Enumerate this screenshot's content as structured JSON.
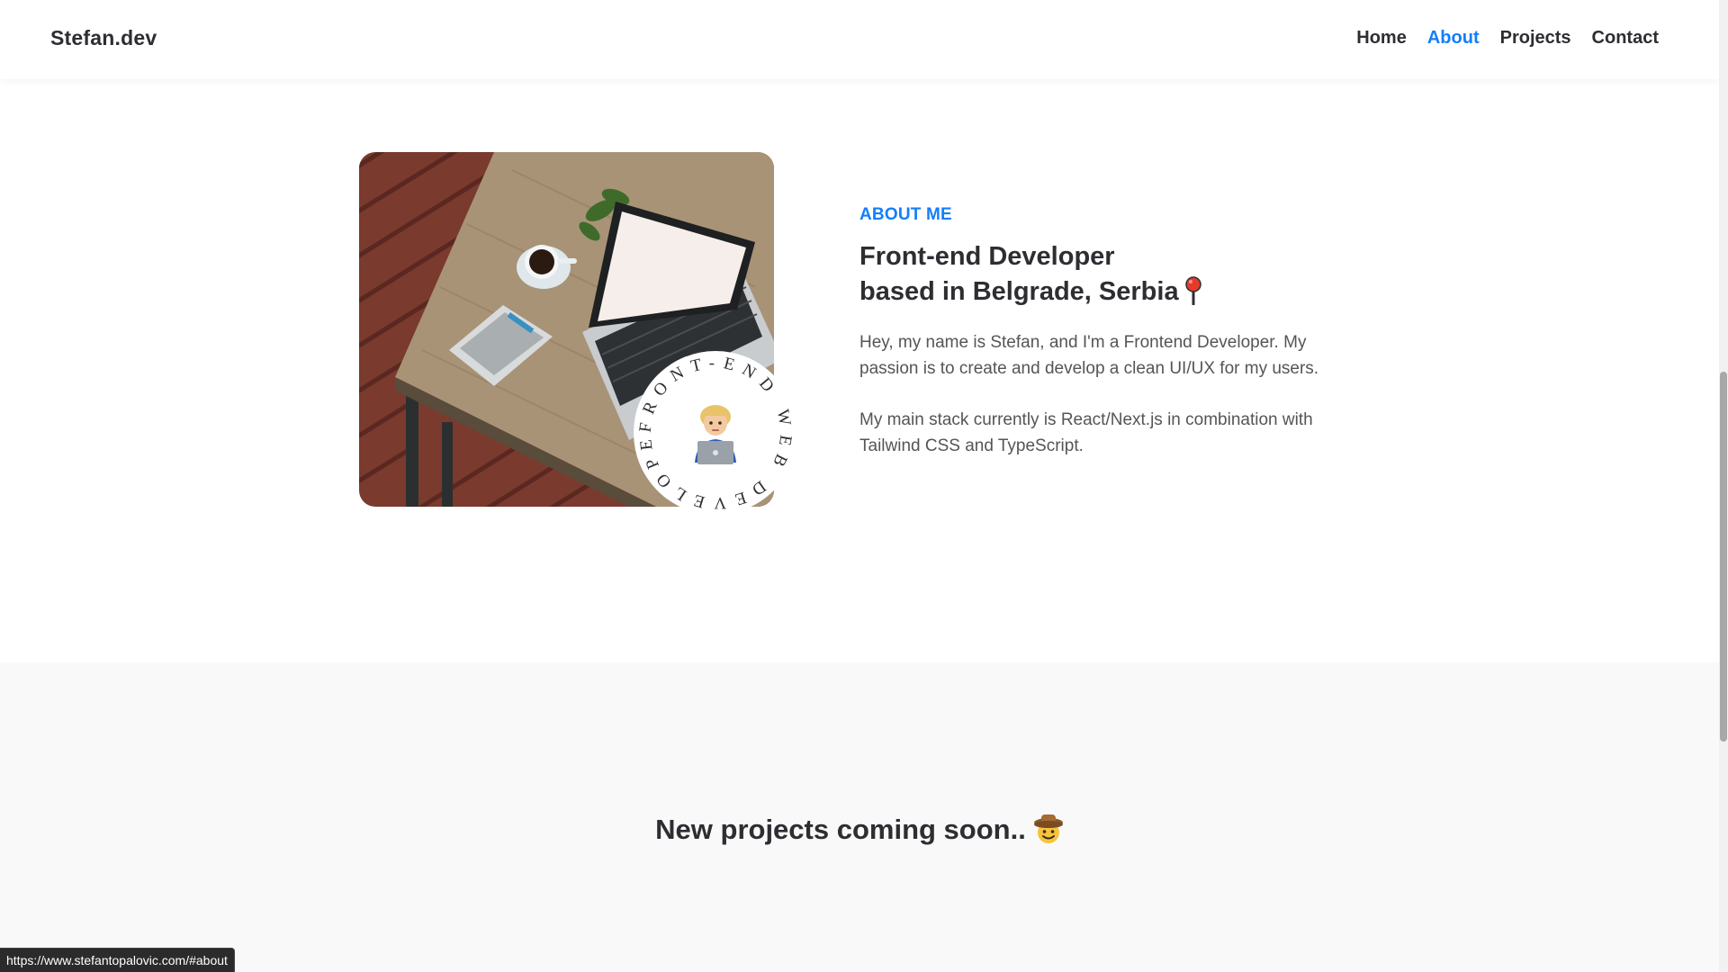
{
  "header": {
    "logo": "Stefan.dev",
    "nav": [
      {
        "label": "Home"
      },
      {
        "label": "About",
        "active": true
      },
      {
        "label": "Projects"
      },
      {
        "label": "Contact"
      }
    ]
  },
  "about": {
    "tag": "ABOUT ME",
    "title_line1": "Front-end Developer",
    "title_line2": "based in Belgrade, Serbia",
    "title_icon": "round-pushpin-icon",
    "paragraph1": "Hey, my name is Stefan, and I'm a Frontend Developer. My passion is to create and develop a clean UI/UX for my users.",
    "paragraph2": "My main stack currently is React/Next.js in combination with Tailwind CSS and TypeScript.",
    "badge_text": "FRONT-END WEB DEVELOPER",
    "badge_icon": "technologist-emoji-icon"
  },
  "projects": {
    "title": "New projects coming soon..",
    "title_icon": "cowboy-face-icon"
  },
  "statusbar": {
    "url": "https://www.stefantopalovic.com/#about"
  },
  "colors": {
    "accent": "#147efb",
    "text": "#2d2e32",
    "body_text": "#555555",
    "section_bg": "#f9f9f9"
  }
}
